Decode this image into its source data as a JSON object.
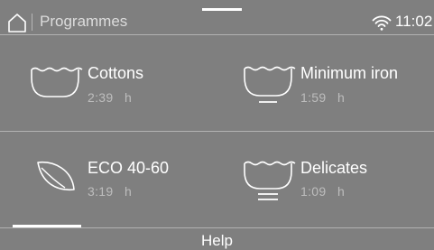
{
  "header": {
    "title": "Programmes",
    "clock": "11:02",
    "home_icon": "home-icon",
    "wifi_icon": "wifi-icon"
  },
  "programmes": [
    {
      "name": "Cottons",
      "duration": "2:39",
      "unit": "h",
      "icon": "basin-icon"
    },
    {
      "name": "Minimum iron",
      "duration": "1:59",
      "unit": "h",
      "icon": "basin-single-bar-icon"
    },
    {
      "name": "ECO 40-60",
      "duration": "3:19",
      "unit": "h",
      "icon": "leaf-icon"
    },
    {
      "name": "Delicates",
      "duration": "1:09",
      "unit": "h",
      "icon": "basin-double-bar-icon"
    }
  ],
  "footer": {
    "help_label": "Help"
  },
  "colors": {
    "background": "#7f7f7f",
    "text": "#ffffff",
    "secondary_text": "#bdbdbd",
    "divider": "#b2b2b2"
  }
}
